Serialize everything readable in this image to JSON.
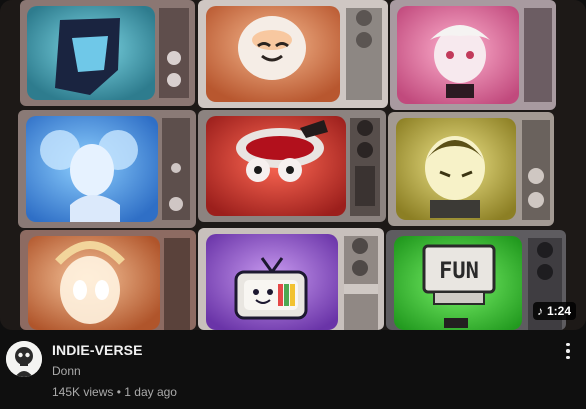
{
  "video": {
    "title": "INDIE-VERSE",
    "channel": "Donn",
    "views": "145K views",
    "separator": "•",
    "age": "1 day ago",
    "duration": "1:24",
    "duration_icon": "music-note-icon",
    "thumbnail_sign_text": "FUN"
  },
  "icons": {
    "more": "vertical-ellipsis-icon",
    "avatar": "skull-avatar-icon"
  },
  "colors": {
    "background": "#0f0f0f",
    "title": "#f1f1f1",
    "secondary_text": "#aaaaaa"
  }
}
